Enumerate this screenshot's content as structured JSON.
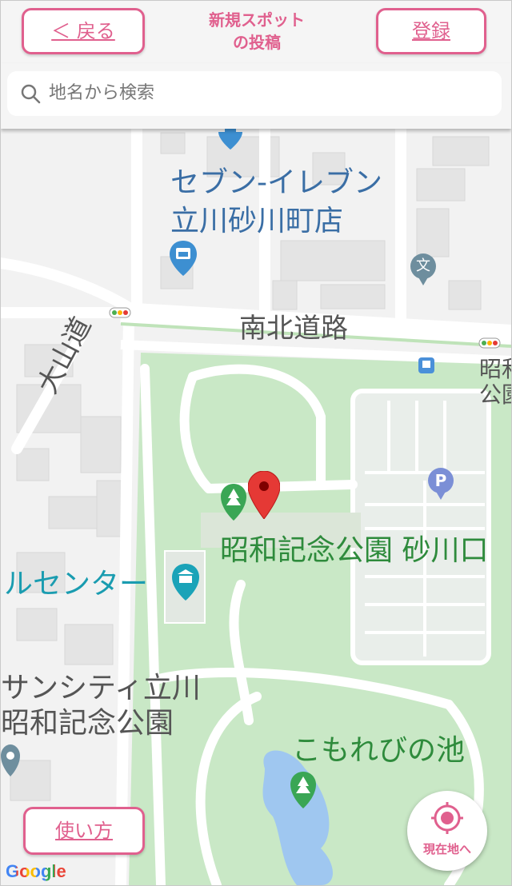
{
  "header": {
    "back_label": "＜ 戻る",
    "title_line1": "新規スポット",
    "title_line2": "の投稿",
    "register_label": "登録"
  },
  "search": {
    "placeholder": "地名から検索"
  },
  "map": {
    "labels": {
      "seven_eleven_1": "セブン-イレブン",
      "seven_eleven_2": "立川砂川町店",
      "nanboku": "南北道路",
      "oyama": "大山道",
      "showa_right_1": "昭和",
      "showa_right_2": "公園",
      "park_entrance": "昭和記念公園 砂川口",
      "center": "ルセンター",
      "suncity_1": "サンシティ立川",
      "suncity_2": "昭和記念公園",
      "pond": "こもれびの池"
    },
    "icons": {
      "school_glyph": "文",
      "parking_glyph": "P"
    },
    "colors": {
      "park": "#c9e8c6",
      "road": "#ffffff",
      "pin": "#e53935",
      "water": "#9fc7f0",
      "accent": "#e0608e"
    }
  },
  "footer": {
    "usage_label": "使い方",
    "current_location_label": "現在地へ",
    "google_logo": "Google"
  }
}
